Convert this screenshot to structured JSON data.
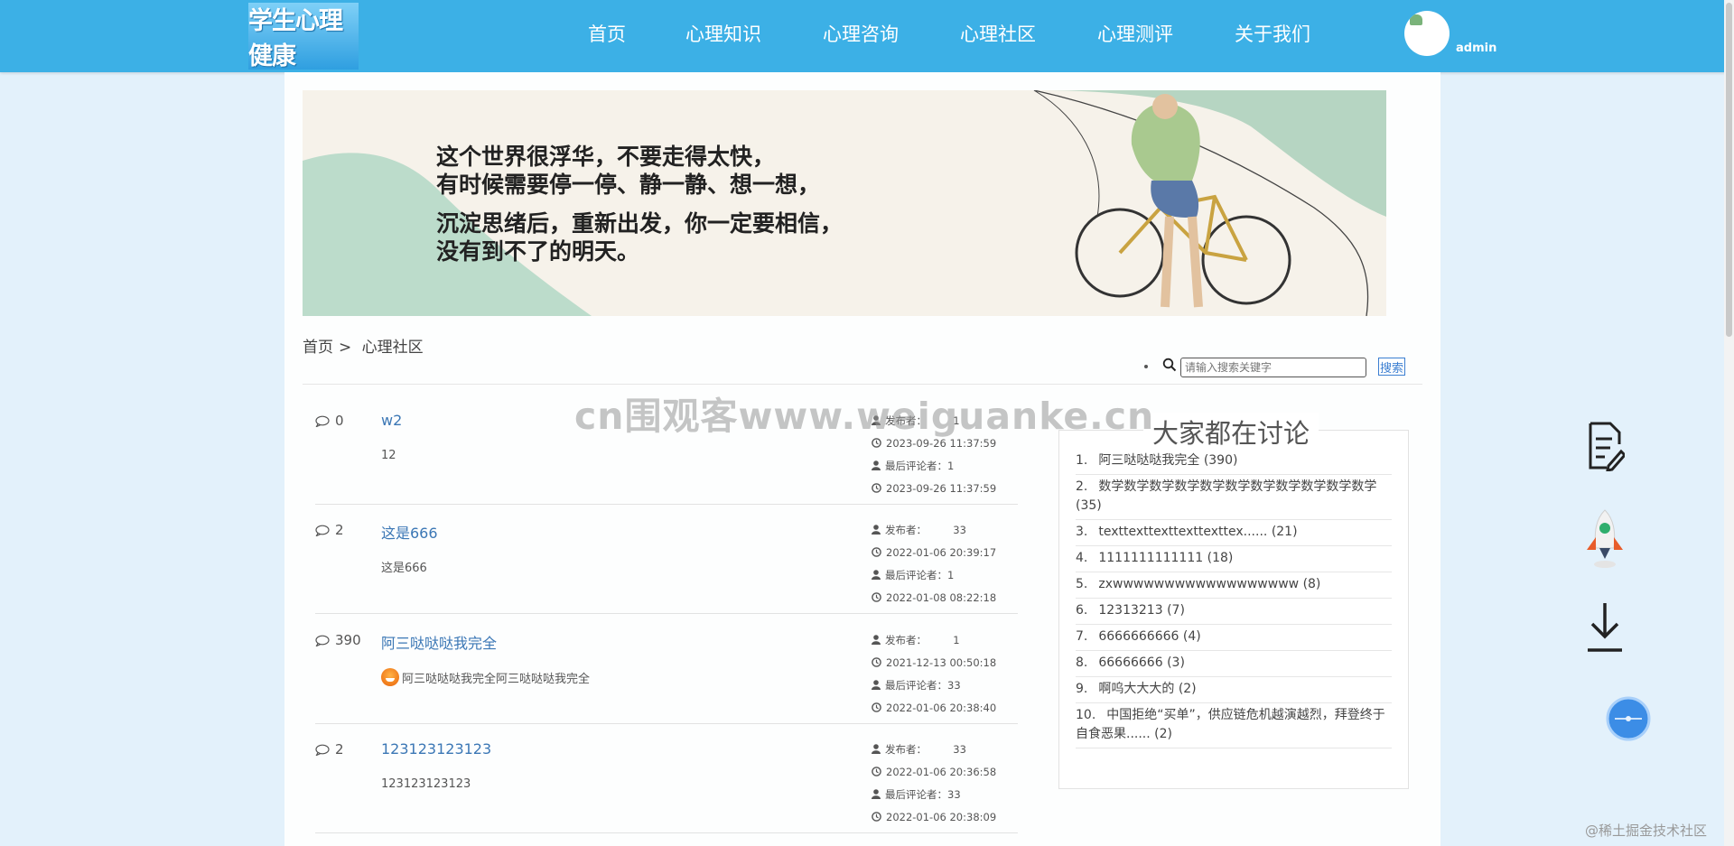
{
  "header": {
    "logo_text": "学生心理健康",
    "nav": [
      "首页",
      "心理知识",
      "心理咨询",
      "心理社区",
      "心理测评",
      "关于我们"
    ],
    "username": "admin"
  },
  "banner": {
    "paragraphs": [
      [
        "这个世界很浮华，不要走得太快，",
        "有时候需要停一停、静一静、想一想，"
      ],
      [
        "沉淀思绪后，重新出发，你一定要相信，",
        "没有到不了的明天。"
      ]
    ]
  },
  "breadcrumb": {
    "home": "首页",
    "separator": ">",
    "current": "心理社区"
  },
  "search": {
    "placeholder": "请输入搜索关键字",
    "button": "搜索"
  },
  "posts": [
    {
      "count": "0",
      "title": "w2",
      "body": "12",
      "has_emoji": false,
      "publisher_label": "发布者：",
      "publisher": "1",
      "published": "2023-09-26 11:37:59",
      "last_commenter_label": "最后评论者：",
      "last_commenter": "1",
      "last_comment_time": "2023-09-26 11:37:59"
    },
    {
      "count": "2",
      "title": "这是666",
      "body": "这是666",
      "has_emoji": false,
      "publisher_label": "发布者：",
      "publisher": "33",
      "published": "2022-01-06 20:39:17",
      "last_commenter_label": "最后评论者：",
      "last_commenter": "1",
      "last_comment_time": "2022-01-08 08:22:18"
    },
    {
      "count": "390",
      "title": "阿三哒哒哒我完全",
      "body": "阿三哒哒哒我完全阿三哒哒哒我完全",
      "has_emoji": true,
      "publisher_label": "发布者：",
      "publisher": "1",
      "published": "2021-12-13 00:50:18",
      "last_commenter_label": "最后评论者：",
      "last_commenter": "33",
      "last_comment_time": "2022-01-06 20:38:40"
    },
    {
      "count": "2",
      "title": "123123123123",
      "body": "123123123123",
      "has_emoji": false,
      "publisher_label": "发布者：",
      "publisher": "33",
      "published": "2022-01-06 20:36:58",
      "last_commenter_label": "最后评论者：",
      "last_commenter": "33",
      "last_comment_time": "2022-01-06 20:38:09"
    }
  ],
  "discussion": {
    "title": "大家都在讨论",
    "items": [
      {
        "num": "1.",
        "text": "阿三哒哒哒我完全",
        "count": "(390)"
      },
      {
        "num": "2.",
        "text": "数学数学数学数学数学数学数学数学数学数学数学",
        "count": "(35)"
      },
      {
        "num": "3.",
        "text": "texttexttexttexttexttex......",
        "count": "(21)"
      },
      {
        "num": "4.",
        "text": "1111111111111",
        "count": "(18)"
      },
      {
        "num": "5.",
        "text": "zxwwwwwwwwwwwwwwwwww",
        "count": "(8)"
      },
      {
        "num": "6.",
        "text": "12313213",
        "count": "(7)"
      },
      {
        "num": "7.",
        "text": "6666666666",
        "count": "(4)"
      },
      {
        "num": "8.",
        "text": "66666666",
        "count": "(3)"
      },
      {
        "num": "9.",
        "text": "啊呜大大大的",
        "count": "(2)"
      },
      {
        "num": "10.",
        "text": "中国拒绝“买单”，供应链危机越演越烈，拜登终于自食恶果......",
        "count": "(2)"
      }
    ]
  },
  "float_icons": [
    "document-edit-icon",
    "rocket-icon",
    "download-icon",
    "back-to-top-icon"
  ],
  "watermarks": {
    "center": "cn围观客www.weiguanke.cn",
    "corner": "@稀土掘金技术社区"
  },
  "colors": {
    "header": "#3cb0e6",
    "page_bg": "#e3f1fb",
    "link": "#3b77b5"
  }
}
